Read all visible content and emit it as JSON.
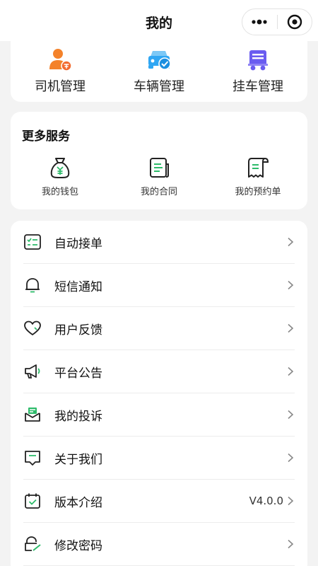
{
  "header": {
    "title": "我的"
  },
  "management": [
    {
      "label": "司机管理",
      "icon": "driver-icon"
    },
    {
      "label": "车辆管理",
      "icon": "vehicle-icon"
    },
    {
      "label": "挂车管理",
      "icon": "trailer-icon"
    }
  ],
  "services": {
    "title": "更多服务",
    "items": [
      {
        "label": "我的钱包",
        "icon": "wallet-icon"
      },
      {
        "label": "我的合同",
        "icon": "contract-icon"
      },
      {
        "label": "我的预约单",
        "icon": "reservation-icon"
      }
    ]
  },
  "menu": [
    {
      "label": "自动接单",
      "icon": "auto-order-icon",
      "value": ""
    },
    {
      "label": "短信通知",
      "icon": "bell-icon",
      "value": ""
    },
    {
      "label": "用户反馈",
      "icon": "heart-icon",
      "value": ""
    },
    {
      "label": "平台公告",
      "icon": "megaphone-icon",
      "value": ""
    },
    {
      "label": "我的投诉",
      "icon": "complaint-icon",
      "value": ""
    },
    {
      "label": "关于我们",
      "icon": "about-icon",
      "value": ""
    },
    {
      "label": "版本介绍",
      "icon": "calendar-check-icon",
      "value": "V4.0.0"
    },
    {
      "label": "修改密码",
      "icon": "edit-password-icon",
      "value": ""
    }
  ],
  "colors": {
    "accent_green": "#2dbb6a",
    "driver_orange": "#f4822a",
    "vehicle_blue": "#2fa6f3",
    "trailer_purple": "#6a5cf0"
  }
}
